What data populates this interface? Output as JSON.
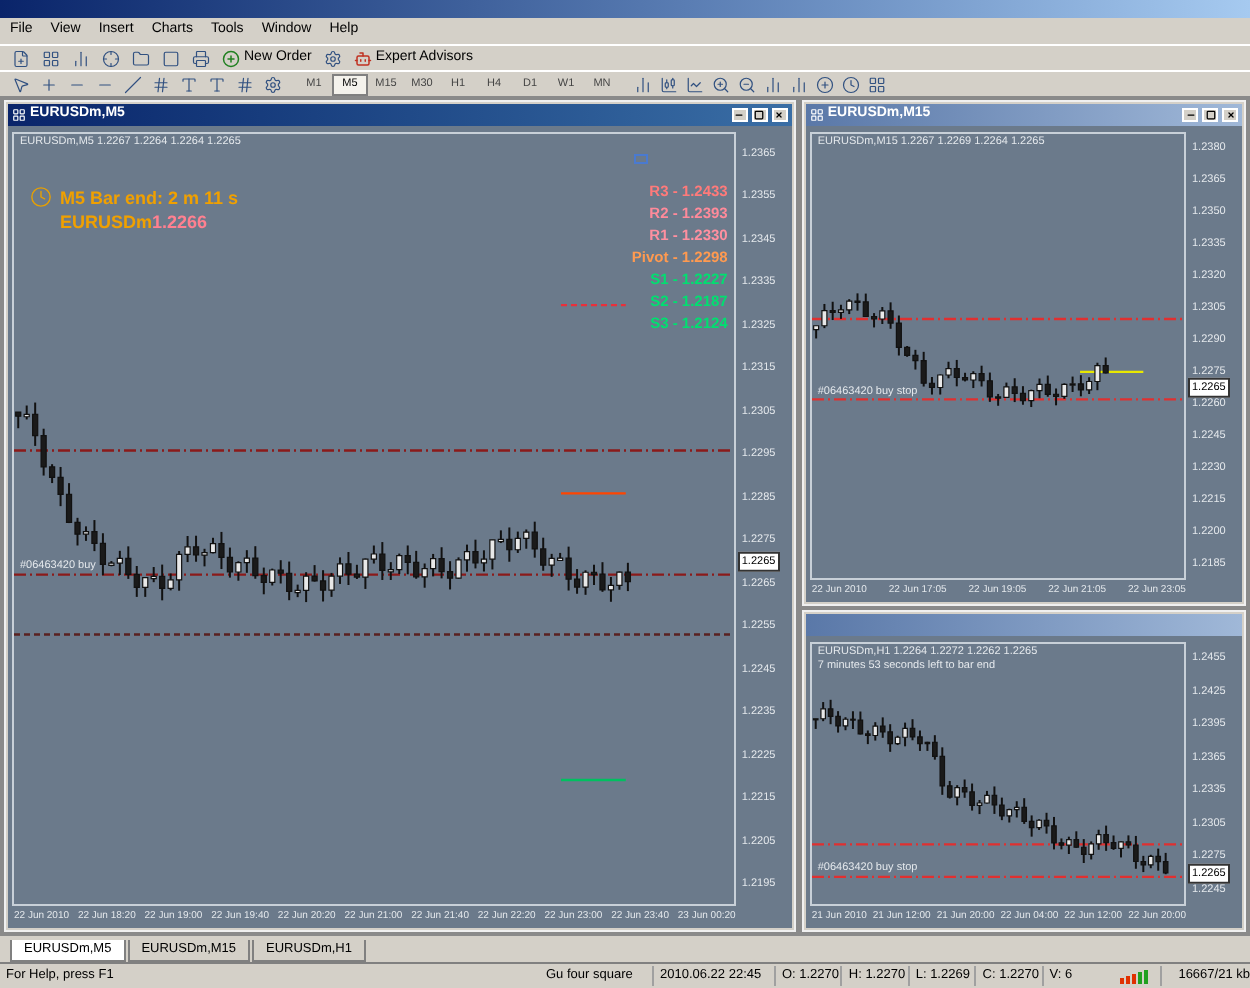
{
  "menu": [
    "File",
    "View",
    "Insert",
    "Charts",
    "Tools",
    "Window",
    "Help"
  ],
  "toolbar": {
    "buttons": [
      {
        "label": "New Order"
      },
      {
        "label": "Expert Advisors"
      }
    ],
    "timeframes": [
      {
        "label": "M1",
        "selected": false
      },
      {
        "label": "M5",
        "selected": true
      },
      {
        "label": "M15",
        "selected": false
      },
      {
        "label": "M30",
        "selected": false
      },
      {
        "label": "H1",
        "selected": false
      },
      {
        "label": "H4",
        "selected": false
      },
      {
        "label": "D1",
        "selected": false
      },
      {
        "label": "W1",
        "selected": false
      },
      {
        "label": "MN",
        "selected": false
      }
    ]
  },
  "windows": [
    {
      "title": "EURUSDm,M5",
      "active": true,
      "info": [
        "EURUSDm,M5  1.2267 1.2264 1.2264 1.2265"
      ],
      "bar_timer": "M5 Bar end: 2 m 11 s",
      "symbol": "EURUSDm",
      "symbol_price": "1.2266",
      "pivots": [
        {
          "label": "R3 - 1.2433",
          "color": "#ff7a7a"
        },
        {
          "label": "R2 - 1.2393",
          "color": "#ff8a9a"
        },
        {
          "label": "R1 - 1.2330",
          "color": "#ff90a0"
        },
        {
          "label": "Pivot - 1.2298",
          "color": "#ff9a50"
        },
        {
          "label": "S1 - 1.2227",
          "color": "#00e070"
        },
        {
          "label": "S2 - 1.2187",
          "color": "#00e070"
        },
        {
          "label": "S3 - 1.2124",
          "color": "#00e070"
        }
      ],
      "order_label": "#06463420 buy",
      "price_box": "1.2265",
      "price_axis": [
        "1.2365",
        "1.2355",
        "1.2345",
        "1.2335",
        "1.2325",
        "1.2315",
        "1.2305",
        "1.2295",
        "1.2285",
        "1.2275",
        "1.2265",
        "1.2255",
        "1.2245",
        "1.2235",
        "1.2225",
        "1.2215",
        "1.2205",
        "1.2195"
      ],
      "time_axis": [
        "22 Jun 2010",
        "22 Jun 18:20",
        "22 Jun 19:00",
        "22 Jun 19:40",
        "22 Jun 20:20",
        "22 Jun 21:00",
        "22 Jun 21:40",
        "22 Jun 22:20",
        "22 Jun 23:00",
        "22 Jun 23:40",
        "23 Jun 00:20"
      ]
    },
    {
      "title": "EURUSDm,M15",
      "active": false,
      "info": [
        "EURUSDm,M15  1.2267 1.2269 1.2264 1.2265"
      ],
      "order_label": "#06463420 buy stop",
      "price_box": "1.2265",
      "price_axis": [
        "1.2380",
        "1.2365",
        "1.2350",
        "1.2335",
        "1.2320",
        "1.2305",
        "1.2290",
        "1.2275",
        "1.2260",
        "1.2245",
        "1.2230",
        "1.2215",
        "1.2200",
        "1.2185"
      ],
      "time_axis": [
        "22 Jun 2010",
        "22 Jun 17:05",
        "22 Jun 19:05",
        "22 Jun 21:05",
        "22 Jun 23:05"
      ]
    },
    {
      "active": false,
      "info": [
        "EURUSDm,H1  1.2264 1.2272 1.2262 1.2265",
        "7 minutes 53 seconds left to bar end"
      ],
      "order_label": "#06463420 buy stop",
      "price_box": "1.2265",
      "price_axis": [
        "1.2455",
        "1.2425",
        "1.2395",
        "1.2365",
        "1.2335",
        "1.2305",
        "1.2275",
        "1.2245"
      ],
      "time_axis": [
        "21 Jun 2010",
        "21 Jun 12:00",
        "21 Jun 20:00",
        "22 Jun 04:00",
        "22 Jun 12:00",
        "22 Jun 20:00"
      ]
    }
  ],
  "tabs": [
    {
      "label": "EURUSDm,M5",
      "selected": true
    },
    {
      "label": "EURUSDm,M15",
      "selected": false
    },
    {
      "label": "EURUSDm,H1",
      "selected": false
    }
  ],
  "status_bar": {
    "help": "For Help, press F1",
    "profile": "Gu four square",
    "fields": [
      "2010.06.22 22:45",
      "O: 1.2270",
      "H: 1.2270",
      "L: 1.2269",
      "C: 1.2270",
      "V: 6"
    ],
    "traffic": "16667/21 kb"
  }
}
